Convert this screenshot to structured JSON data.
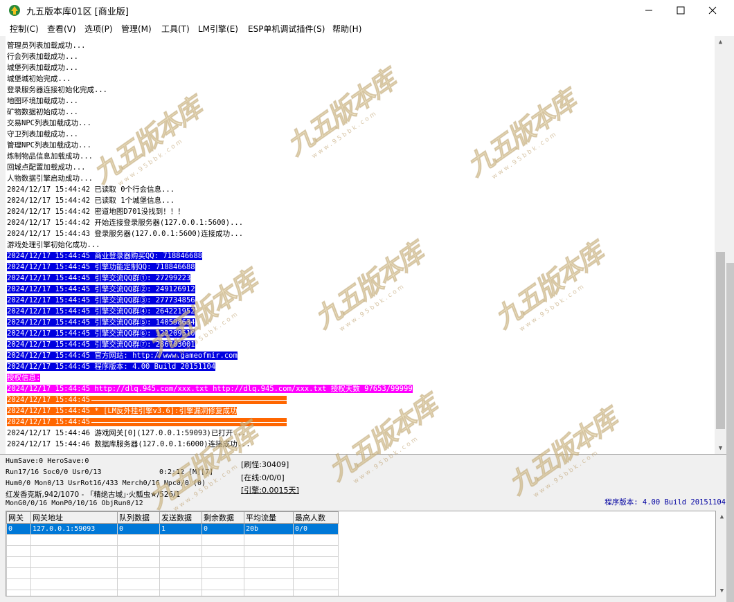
{
  "window": {
    "title": "九五版本库01区 [商业版]",
    "controls": {
      "minimize": "—",
      "maximize": "☐",
      "close": "✕"
    }
  },
  "menu": [
    {
      "label": "控制(C)"
    },
    {
      "label": "查看(V)"
    },
    {
      "label": "选项(P)"
    },
    {
      "label": "管理(M)"
    },
    {
      "label": "工具(T)"
    },
    {
      "label": "LM引擎(E)"
    },
    {
      "label": "ESP单机调试插件(S)"
    },
    {
      "label": "帮助(H)"
    }
  ],
  "log": [
    {
      "text": "管理员列表加载成功...",
      "style": "plain"
    },
    {
      "text": "行会列表加载成功...",
      "style": "plain"
    },
    {
      "text": "城堡列表加载成功...",
      "style": "plain"
    },
    {
      "text": "城堡城初始完成...",
      "style": "plain"
    },
    {
      "text": "登录服务器连接初始化完成...",
      "style": "plain"
    },
    {
      "text": "地图环境加载成功...",
      "style": "plain"
    },
    {
      "text": "矿物数据初始成功...",
      "style": "plain"
    },
    {
      "text": "交易NPC列表加载成功...",
      "style": "plain"
    },
    {
      "text": "守卫列表加载成功...",
      "style": "plain"
    },
    {
      "text": "管理NPC列表加载成功...",
      "style": "plain"
    },
    {
      "text": "炼制物品信息加载成功...",
      "style": "plain"
    },
    {
      "text": "回城点配置加载成功...",
      "style": "plain"
    },
    {
      "text": "人物数据引擎启动成功...",
      "style": "plain"
    },
    {
      "text": "2024/12/17 15:44:42 已读取 0个行会信息...",
      "style": "plain"
    },
    {
      "text": "2024/12/17 15:44:42 已读取 1个城堡信息...",
      "style": "plain"
    },
    {
      "text": "2024/12/17 15:44:42 密道地图D701没找到！！！",
      "style": "plain"
    },
    {
      "text": "2024/12/17 15:44:42 开始连接登录服务器(127.0.0.1:5600)...",
      "style": "plain"
    },
    {
      "text": "2024/12/17 15:44:43 登录服务器(127.0.0.1:5600)连接成功...",
      "style": "plain"
    },
    {
      "text": "游戏处理引擎初始化成功...",
      "style": "plain"
    },
    {
      "text": "2024/12/17 15:44:45 商业登录器购买QQ: 718846688",
      "style": "blue"
    },
    {
      "text": "2024/12/17 15:44:45 引擎功能定制QQ: 718846688",
      "style": "blue"
    },
    {
      "text": "2024/12/17 15:44:45 引擎交流QQ群①: 27299223",
      "style": "blue"
    },
    {
      "text": "2024/12/17 15:44:45 引擎交流QQ群②: 249126912",
      "style": "blue"
    },
    {
      "text": "2024/12/17 15:44:45 引擎交流QQ群③: 277734856",
      "style": "blue"
    },
    {
      "text": "2024/12/17 15:44:45 引擎交流QQ群④: 264221952",
      "style": "blue"
    },
    {
      "text": "2024/12/17 15:44:45 引擎交流QQ群⑤: 140598634",
      "style": "blue"
    },
    {
      "text": "2024/12/17 15:44:45 引擎交流QQ群⑥: 122209510",
      "style": "blue"
    },
    {
      "text": "2024/12/17 15:44:45 引擎交流QQ群⑦: 286703001",
      "style": "blue"
    },
    {
      "text": "2024/12/17 15:44:45 官方网站: http://www.gameofmir.com",
      "style": "blue"
    },
    {
      "text": "2024/12/17 15:44:45 程序版本: 4.00 Build 20151104",
      "style": "blue"
    },
    {
      "text": "授权信息:",
      "style": "magenta"
    },
    {
      "text": "2024/12/17 15:44:45 http://dlq.945.com/xxx.txt http://dlq.945.com/xxx.txt 授权天数 97653/99999",
      "style": "magenta"
    },
    {
      "text": "2024/12/17 15:44:45",
      "style": "orange-rule"
    },
    {
      "text": "2024/12/17 15:44:45 * [LM反外挂引擎v3.6]:引擎漏洞修复成功",
      "style": "orange"
    },
    {
      "text": "2024/12/17 15:44:45",
      "style": "orange-rule"
    },
    {
      "text": "2024/12/17 15:44:46 游戏网关[0](127.0.0.1:59093)已打开...",
      "style": "plain"
    },
    {
      "text": "2024/12/17 15:44:46 数据库服务器(127.0.0.1:6000)连接成功...",
      "style": "plain"
    }
  ],
  "status": {
    "line1": "HumSave:0 HeroSave:0",
    "line2": "Run17/16 Soc0/0 Usr0/13",
    "time": "0:2:12",
    "flags": "[M][7]",
    "line3": "Hum0/0 Mon0/13 UsrRot16/433 Merch0/16 Npc0/0 (0)",
    "line4": "红发香克斯,942/1070 - 「精绝古城」·火瓢虫★/526/1",
    "line5": "MonG0/0/16 MonP0/10/16 ObjRun0/12",
    "refresh": "[刷怪:30409]",
    "online": "[在线:0/0/0]",
    "engine": "[引擎:0.0015天]",
    "version": "程序版本: 4.00 Build 20151104"
  },
  "gateway_table": {
    "headers": [
      "网关",
      "网关地址",
      "队列数据",
      "发送数据",
      "剩余数据",
      "平均流量",
      "最高人数"
    ],
    "rows": [
      [
        "0",
        "127.0.0.1:59093",
        "0",
        "1",
        "0",
        "20b",
        "0/0"
      ]
    ]
  },
  "watermark": {
    "main": "九五版本库",
    "sub": "www.95bbk.com"
  },
  "colors": {
    "blue": "#0000e0",
    "magenta": "#ff00ff",
    "orange": "#ff6600",
    "selection": "#0078d7"
  }
}
